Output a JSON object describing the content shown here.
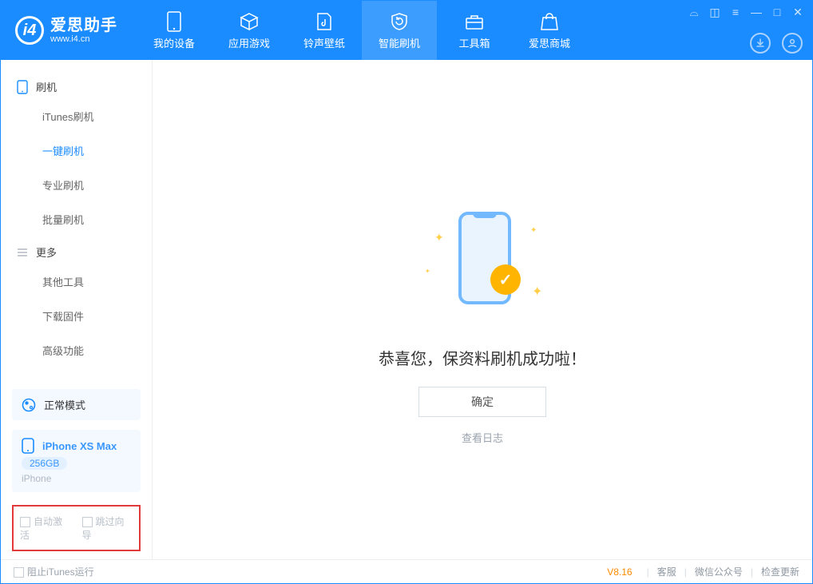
{
  "app": {
    "title": "爱思助手",
    "site": "www.i4.cn"
  },
  "header_tabs": {
    "device": "我的设备",
    "apps": "应用游戏",
    "media": "铃声壁纸",
    "flash": "智能刷机",
    "toolbox": "工具箱",
    "store": "爱思商城"
  },
  "sidebar": {
    "group_flash": "刷机",
    "items_flash": {
      "itunes": "iTunes刷机",
      "onekey": "一键刷机",
      "pro": "专业刷机",
      "batch": "批量刷机"
    },
    "group_more": "更多",
    "items_more": {
      "other": "其他工具",
      "firmware": "下载固件",
      "advanced": "高级功能"
    },
    "mode_box": "正常模式",
    "device_box": {
      "name": "iPhone XS Max",
      "storage": "256GB",
      "subtype": "iPhone"
    },
    "checks": {
      "auto_activate": "自动激活",
      "skip_guide": "跳过向导"
    }
  },
  "main": {
    "success_text": "恭喜您，保资料刷机成功啦！",
    "confirm_btn": "确定",
    "view_log": "查看日志"
  },
  "footer": {
    "block_itunes": "阻止iTunes运行",
    "version": "V8.16",
    "support": "客服",
    "wechat": "微信公众号",
    "update": "检查更新"
  }
}
